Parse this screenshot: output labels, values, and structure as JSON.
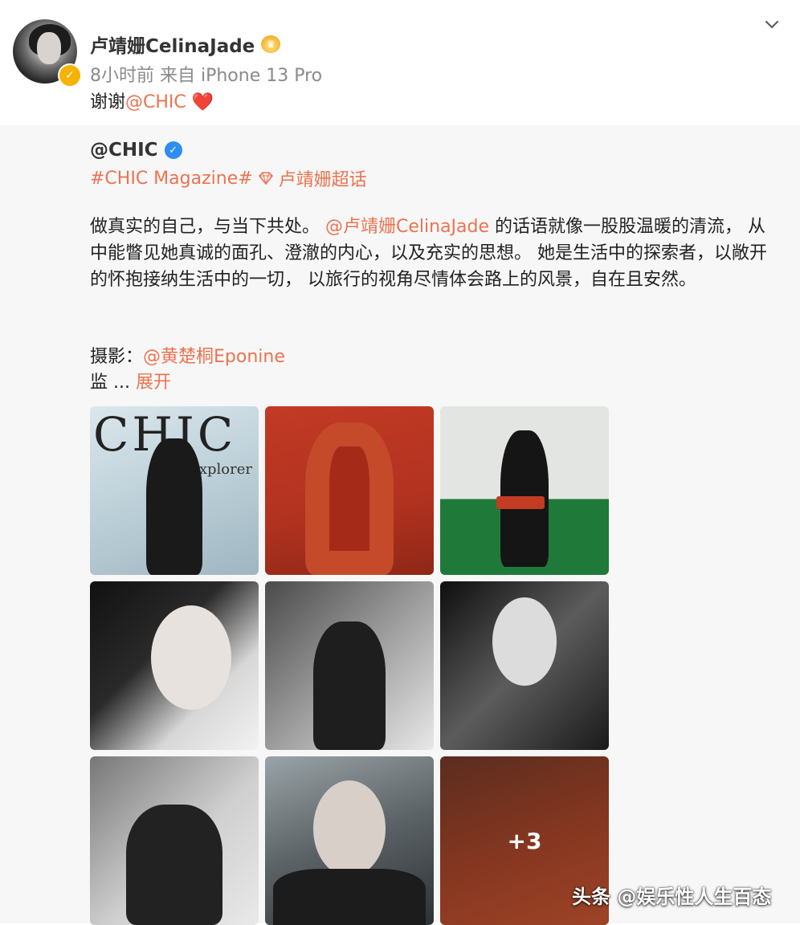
{
  "post": {
    "username": "卢靖姗CelinaJade",
    "meta": "8小时前  来自 iPhone 13 Pro",
    "text_prefix": "谢谢",
    "text_mention": "@CHIC",
    "heart": "❤️"
  },
  "repost": {
    "username": "@CHIC",
    "topic_1": "#CHIC Magazine#",
    "topic_2": "卢靖姗超话",
    "body_part1": "做真实的自己，与当下共处。",
    "body_mention": "@卢靖姗CelinaJade",
    "body_part2": " 的话语就像一股股温暖的清流， 从中能瞥见她真诚的面孔、澄澈的内心，以及充实的思想。 她是生活中的探索者，以敞开的怀抱接纳生活中的一切， 以旅行的视角尽情体会路上的风景，自在且安然。",
    "photo_label": "摄影：",
    "photo_mention": "@黄楚桐Eponine",
    "more_prefix": "监  ...",
    "more_link": "展开"
  },
  "images": {
    "cover_title": "CHIC",
    "cover_subtitle": "Life explorer",
    "more_count": "+3"
  },
  "watermark": "头条 @娱乐性人生百态",
  "icons": {
    "verified": "gold-verified-icon",
    "crown": "crown-icon",
    "blue_v": "blue-verified-icon",
    "gem": "gem-icon",
    "chevron": "chevron-down-icon"
  },
  "colors": {
    "link": "#eb7350",
    "repost_background": "#f7f7f7",
    "heart": "#e0292b"
  }
}
